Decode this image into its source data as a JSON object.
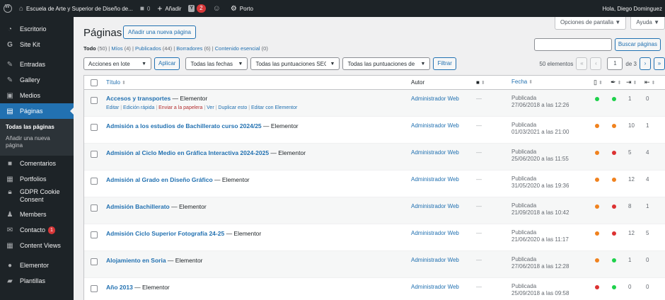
{
  "adminbar": {
    "site_name": "Escuela de Arte y Superior de Diseño de...",
    "comments_count": "0",
    "new_label": "Añadir",
    "notif_count": "2",
    "theme_label": "Porto",
    "greeting": "Hola, Diego Dominguez"
  },
  "sidebar": {
    "items": [
      {
        "label": "Escritorio",
        "icon": "dashboard-icon"
      },
      {
        "label": "Site Kit",
        "icon": "site-kit-icon"
      },
      {
        "label": "Entradas",
        "icon": "pin-icon"
      },
      {
        "label": "Gallery",
        "icon": "pin-icon"
      },
      {
        "label": "Medios",
        "icon": "media-icon"
      },
      {
        "label": "Páginas",
        "icon": "page-icon"
      }
    ],
    "submenu": [
      "Todas las páginas",
      "Añadir una nueva página"
    ],
    "items2": [
      {
        "label": "Comentarios",
        "icon": "comment-icon"
      },
      {
        "label": "Portfolios",
        "icon": "portfolio-icon"
      },
      {
        "label": "GDPR Cookie Consent",
        "icon": "lock-icon"
      },
      {
        "label": "Members",
        "icon": "user-icon"
      },
      {
        "label": "Contacto",
        "icon": "mail-icon",
        "badge": "1"
      },
      {
        "label": "Content Views",
        "icon": "grid-icon"
      },
      {
        "label": "Elementor",
        "icon": "elementor-icon"
      },
      {
        "label": "Plantillas",
        "icon": "folder-icon"
      }
    ]
  },
  "screen_meta": {
    "options": "Opciones de pantalla ▼",
    "help": "Ayuda ▼"
  },
  "header": {
    "title": "Páginas",
    "add_new": "Añadir una nueva página"
  },
  "views": {
    "all": "Todo",
    "all_count": "(50)",
    "mine": "Míos",
    "mine_count": "(4)",
    "published": "Publicados",
    "published_count": "(44)",
    "drafts": "Borradores",
    "drafts_count": "(6)",
    "essential": "Contenido esencial",
    "essential_count": "(0)"
  },
  "search": {
    "button": "Buscar páginas"
  },
  "tablenav": {
    "bulk": "Acciones en lote",
    "apply": "Aplicar",
    "dates": "Todas las fechas",
    "scores1": "Todas las puntuaciones SEO",
    "scores2": "Todas las puntuaciones de",
    "filter": "Filtrar",
    "items": "50 elementos",
    "page": "1",
    "of_pages": "de 3"
  },
  "columns": {
    "title": "Título",
    "author": "Autor",
    "date": "Fecha"
  },
  "rows": [
    {
      "title": "Accesos y transportes",
      "suffix": " — Elementor",
      "author": "Administrador Web",
      "comments": "—",
      "status": "Publicada",
      "date": "27/06/2018 a las 12:26",
      "seo": "#1ed14b",
      "read": "#1ed14b",
      "links": "1",
      "linked": "0",
      "actions": {
        "edit": "Editar",
        "quick": "Edición rápida",
        "trash": "Enviar a la papelera",
        "view": "Ver",
        "dup": "Duplicar esto",
        "elementor": "Editar con Elementor"
      }
    },
    {
      "title": "Admisión a los estudios de Bachillerato curso 2024/25",
      "suffix": " — Elementor",
      "author": "Administrador Web",
      "comments": "—",
      "status": "Publicada",
      "date": "01/03/2021 a las 21:00",
      "seo": "#f0821e",
      "read": "#f0821e",
      "links": "10",
      "linked": "1"
    },
    {
      "title": "Admisión al Ciclo Medio en Gráfica Interactiva 2024-2025",
      "suffix": " — Elementor",
      "author": "Administrador Web",
      "comments": "—",
      "status": "Publicada",
      "date": "25/06/2020 a las 11:55",
      "seo": "#f0821e",
      "read": "#dc3232",
      "links": "5",
      "linked": "4"
    },
    {
      "title": "Admisión al Grado en Diseño Gráfico",
      "suffix": " — Elementor",
      "author": "Administrador Web",
      "comments": "—",
      "status": "Publicada",
      "date": "31/05/2020 a las 19:36",
      "seo": "#f0821e",
      "read": "#f0821e",
      "links": "12",
      "linked": "4"
    },
    {
      "title": "Admisión Bachillerato",
      "suffix": " — Elementor",
      "author": "Administrador Web",
      "comments": "—",
      "status": "Publicada",
      "date": "21/09/2018 a las 10:42",
      "seo": "#f0821e",
      "read": "#dc3232",
      "links": "8",
      "linked": "1"
    },
    {
      "title": "Admisión Ciclo Superior Fotografía 24-25",
      "suffix": " — Elementor",
      "author": "Administrador Web",
      "comments": "—",
      "status": "Publicada",
      "date": "21/06/2020 a las 11:17",
      "seo": "#f0821e",
      "read": "#dc3232",
      "links": "12",
      "linked": "5"
    },
    {
      "title": "Alojamiento en Soria",
      "suffix": " — Elementor",
      "author": "Administrador Web",
      "comments": "—",
      "status": "Publicada",
      "date": "27/06/2018 a las 12:28",
      "seo": "#f0821e",
      "read": "#1ed14b",
      "links": "1",
      "linked": "0"
    },
    {
      "title": "Año 2013",
      "suffix": " — Elementor",
      "author": "Administrador Web",
      "comments": "—",
      "status": "Publicada",
      "date": "25/09/2018 a las 09:58",
      "seo": "#dc3232",
      "read": "#1ed14b",
      "links": "0",
      "linked": "0"
    }
  ]
}
